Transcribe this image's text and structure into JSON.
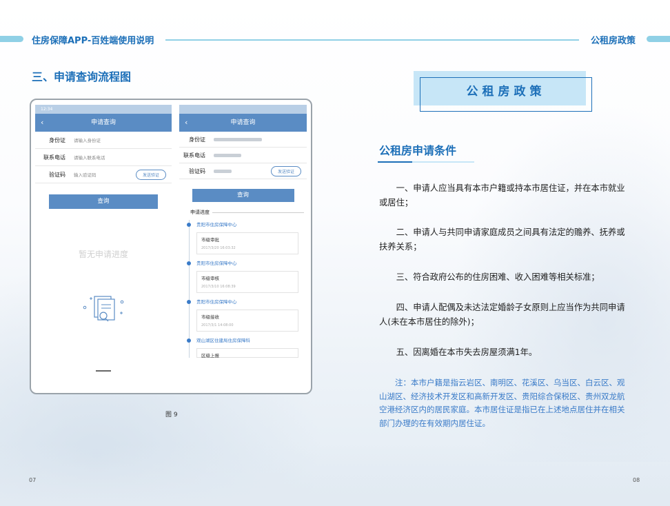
{
  "header": {
    "left_title": "住房保障APP-百姓端使用说明",
    "right_title": "公租房政策"
  },
  "left_page": {
    "section_title": "三、申请查询流程图",
    "figure_caption": "图 9",
    "page_number": "07",
    "phone1": {
      "status_bar": "12:34",
      "nav_title": "申请查询",
      "back_icon": "‹",
      "fields": [
        {
          "label": "身份证",
          "placeholder": "请输入身份证"
        },
        {
          "label": "联系电话",
          "placeholder": "请输入联系电话"
        },
        {
          "label": "验证码",
          "placeholder": "输入验证码"
        }
      ],
      "verify_button": "发送验证",
      "query_button": "查询",
      "empty_text": "暂无申请进度"
    },
    "phone2": {
      "nav_title": "申请查询",
      "back_icon": "‹",
      "fields": [
        {
          "label": "身份证"
        },
        {
          "label": "联系电话"
        },
        {
          "label": "验证码"
        }
      ],
      "verify_button": "发送验证",
      "query_button": "查询",
      "progress_title": "申请进度",
      "timeline": [
        {
          "org": "贵阳市住房保障中心",
          "step": "市级审批",
          "date": "2017/3/20 16:03:32"
        },
        {
          "org": "贵阳市住房保障中心",
          "step": "市级审核",
          "date": "2017/3/10 16:08:39"
        },
        {
          "org": "贵阳市住房保障中心",
          "step": "市级接收",
          "date": "2017/3/1 14:08:00"
        },
        {
          "org": "观山湖区住建局住房保障科",
          "step": "区级上报",
          "date": ""
        }
      ]
    }
  },
  "right_page": {
    "badge": "公租房政策",
    "subtitle": "公租房申请条件",
    "items": [
      "一、申请人应当具有本市户籍或持本市居住证，并在本市就业或居住；",
      "二、申请人与共同申请家庭成员之间具有法定的赡养、抚养或扶养关系；",
      "三、符合政府公布的住房困难、收入困难等相关标准；",
      "四、申请人配偶及未达法定婚龄子女原则上应当作为共同申请人(未在本市居住的除外)；",
      "五、因离婚在本市失去房屋须满1年。"
    ],
    "note": "注：本市户籍是指云岩区、南明区、花溪区、乌当区、白云区、观山湖区、经济技术开发区和高新开发区、贵阳综合保税区、贵州双龙航空港经济区内的居民家庭。本市居住证是指已在上述地点居住并在相关部门办理的在有效期内居住证。",
    "page_number": "08"
  }
}
